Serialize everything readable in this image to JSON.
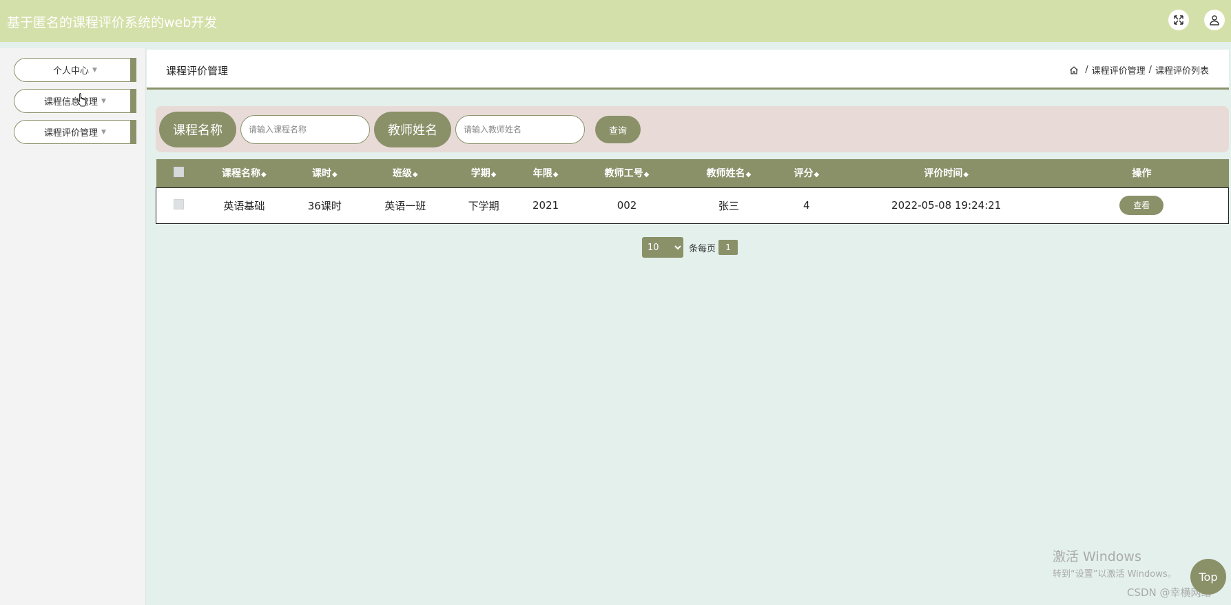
{
  "header": {
    "title": "基于匿名的课程评价系统的web开发",
    "fullscreen_icon": "fullscreen-icon",
    "user_icon": "user-icon"
  },
  "sidebar": {
    "items": [
      {
        "label": "个人中心"
      },
      {
        "label": "课程信息管理"
      },
      {
        "label": "课程评价管理"
      }
    ]
  },
  "content": {
    "page_title": "课程评价管理",
    "breadcrumb": [
      "课程评价管理",
      "课程评价列表"
    ]
  },
  "search": {
    "course_label": "课程名称",
    "course_placeholder": "请输入课程名称",
    "teacher_label": "教师姓名",
    "teacher_placeholder": "请输入教师姓名",
    "query_label": "查询"
  },
  "table": {
    "headers": [
      "课程名称",
      "课时",
      "班级",
      "学期",
      "年限",
      "教师工号",
      "教师姓名",
      "评分",
      "评价时间",
      "操作"
    ],
    "rows": [
      {
        "course": "英语基础",
        "hours": "36课时",
        "class": "英语一班",
        "term": "下学期",
        "year": "2021",
        "teacher_id": "002",
        "teacher_name": "张三",
        "score": "4",
        "time": "2022-05-08 19:24:21",
        "action": "查看"
      }
    ]
  },
  "pager": {
    "page_size": "10",
    "per_page_label": "条每页",
    "current_page": "1"
  },
  "overlay": {
    "watermark_line1": "激活 Windows",
    "watermark_line2": "转到“设置”以激活 Windows。",
    "csdn": "CSDN @幸横网络",
    "top_button": "Top"
  },
  "colors": {
    "accent": "#8a9169",
    "topbar": "#d4e0a9",
    "background": "#e4f0ec",
    "search_bg": "#e8dbd7"
  }
}
